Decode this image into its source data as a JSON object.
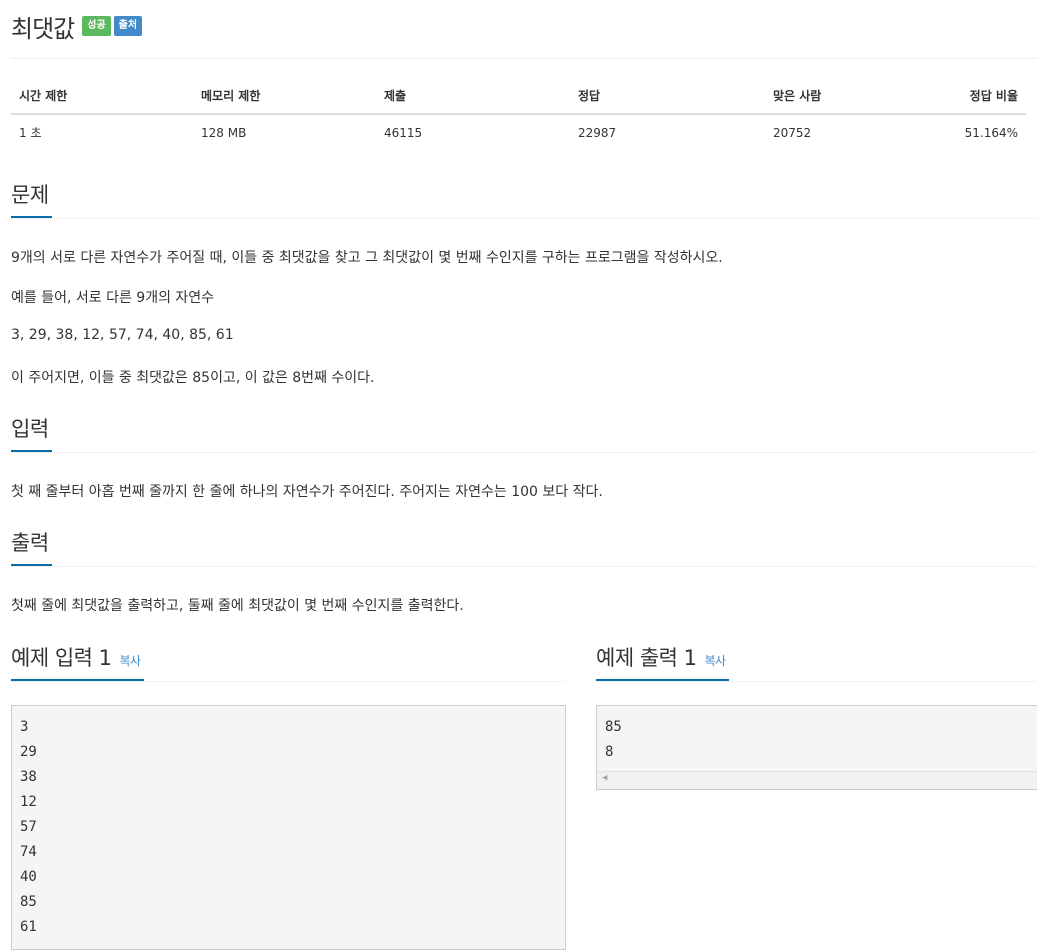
{
  "title": "최댓값",
  "badges": {
    "success": "성공",
    "source": "출처"
  },
  "info_table": {
    "headers": [
      "시간 제한",
      "메모리 제한",
      "제출",
      "정답",
      "맞은 사람",
      "정답 비율"
    ],
    "values": [
      "1 초",
      "128 MB",
      "46115",
      "22987",
      "20752",
      "51.164%"
    ]
  },
  "sections": {
    "problem": {
      "heading": "문제",
      "paragraphs": [
        "9개의 서로 다른 자연수가 주어질 때, 이들 중 최댓값을 찾고 그 최댓값이 몇 번째 수인지를 구하는 프로그램을 작성하시오.",
        "예를 들어, 서로 다른 9개의 자연수",
        "3, 29, 38, 12, 57, 74, 40, 85, 61",
        "이 주어지면, 이들 중 최댓값은 85이고, 이 값은 8번째 수이다."
      ]
    },
    "input": {
      "heading": "입력",
      "paragraphs": [
        "첫 째 줄부터 아홉 번째 줄까지 한 줄에 하나의 자연수가 주어진다. 주어지는 자연수는 100 보다 작다."
      ]
    },
    "output": {
      "heading": "출력",
      "paragraphs": [
        "첫째 줄에 최댓값을 출력하고, 둘째 줄에 최댓값이 몇 번째 수인지를 출력한다."
      ]
    }
  },
  "samples": {
    "input": {
      "heading": "예제 입력 1",
      "copy_label": "복사",
      "lines": [
        "3",
        "29",
        "38",
        "12",
        "57",
        "74",
        "40",
        "85",
        "61"
      ]
    },
    "output": {
      "heading": "예제 출력 1",
      "copy_label": "복사",
      "lines": [
        "85",
        "8"
      ]
    }
  },
  "colors": {
    "accent": "#0a6cad",
    "link": "#428bca",
    "success": "#5cb85c",
    "info": "#428bca"
  },
  "icons": {
    "scroll_left": "chevron-left-icon"
  }
}
